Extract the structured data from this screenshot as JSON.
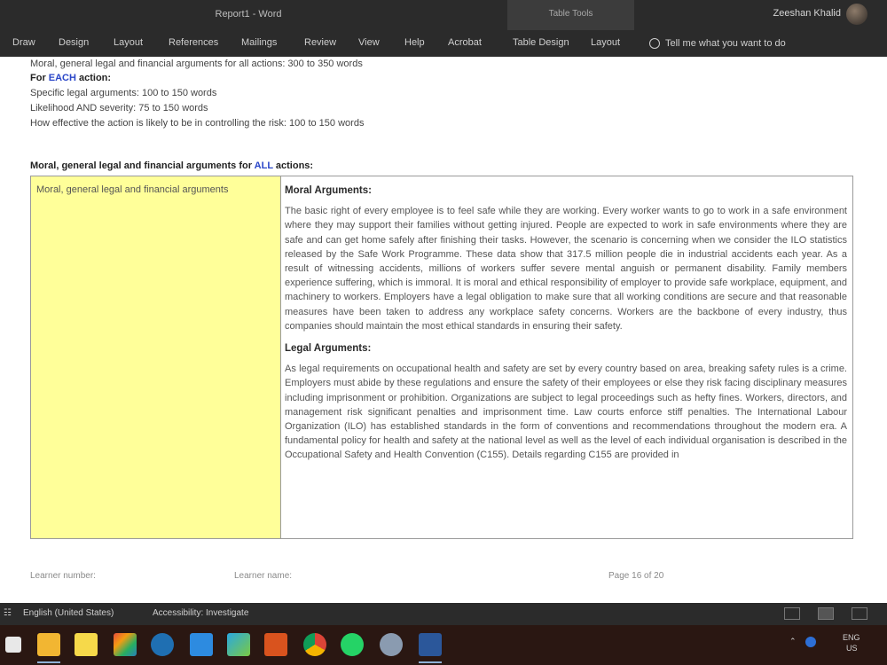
{
  "window": {
    "title": "Report1 - Word",
    "context_tab_title": "Table Tools",
    "user_name": "Zeeshan Khalid"
  },
  "ribbon": {
    "tabs": [
      "Draw",
      "Design",
      "Layout",
      "References",
      "Mailings",
      "Review",
      "View",
      "Help",
      "Acrobat",
      "Table Design",
      "Layout"
    ],
    "tell_me": "Tell me what you want to do"
  },
  "document": {
    "lines": [
      "Moral, general legal and financial arguments for all actions: 300 to 350 words",
      "For EACH action:",
      "Specific legal arguments: 100 to 150 words",
      "Likelihood AND severity: 75 to 150 words",
      "How effective the action is likely to be in controlling the risk: 100 to 150 words"
    ],
    "each_prefix": "For ",
    "each_word": "EACH",
    "each_suffix": " action:",
    "section_heading_prefix": "Moral, general legal and financial arguments for ",
    "section_heading_link": "ALL",
    "section_heading_suffix": " actions:",
    "table": {
      "left_label": "Moral, general legal and financial arguments",
      "moral_heading": "Moral Arguments:",
      "moral_text": "The basic right of every employee is to feel safe while they are working. Every worker wants to go to work in a safe environment where they may support their families without getting injured. People are expected to work in safe environments where they are safe and can get home safely after finishing their tasks. However, the scenario is concerning when we consider the ILO statistics released by the Safe Work Programme. These data show that 317.5 million people die in industrial accidents each year. As a result of witnessing accidents, millions of workers suffer severe mental anguish or permanent disability. Family members experience suffering, which is immoral. It is moral and ethical responsibility of employer to provide safe workplace, equipment, and machinery to workers. Employers have a legal obligation to make sure that all working conditions are secure and that reasonable measures have been taken to address any workplace safety concerns. Workers are the backbone of every industry, thus companies should maintain the most ethical standards in ensuring their safety.",
      "legal_heading": "Legal Arguments:",
      "legal_text": "As legal requirements on occupational health and safety are set by every country based on area, breaking safety rules is a crime. Employers must abide by these regulations and ensure the safety of their employees or else they risk facing disciplinary measures including imprisonment or prohibition. Organizations are subject to legal proceedings such as hefty fines. Workers, directors, and management risk significant penalties and imprisonment time. Law courts enforce stiff penalties. The International Labour Organization (ILO) has established standards in the form of conventions and recommendations throughout the modern era. A fundamental policy for health and safety at the national level as well as the level of each individual organisation is described in the Occupational Safety and Health Convention (C155). Details regarding C155 are provided in"
    },
    "footer": {
      "learner_number": "Learner number:",
      "learner_name": "Learner name:",
      "page": "Page 16 of 20"
    }
  },
  "statusbar": {
    "language": "English (United States)",
    "accessibility": "Accessibility: Investigate"
  },
  "taskbar": {
    "icons": [
      "start-icon",
      "file-explorer-icon",
      "sticky-notes-icon",
      "office-icon",
      "edge-icon",
      "defender-icon",
      "store-icon",
      "xampp-icon",
      "chrome-icon",
      "whatsapp-icon",
      "settings-icon",
      "word-icon"
    ],
    "language": "ENG",
    "region": "US"
  },
  "colors": {
    "chrome_dark": "#2b2b2b",
    "highlight_yellow": "#ffff99",
    "link_blue": "#2a46c8",
    "taskbar": "#2a1712"
  }
}
